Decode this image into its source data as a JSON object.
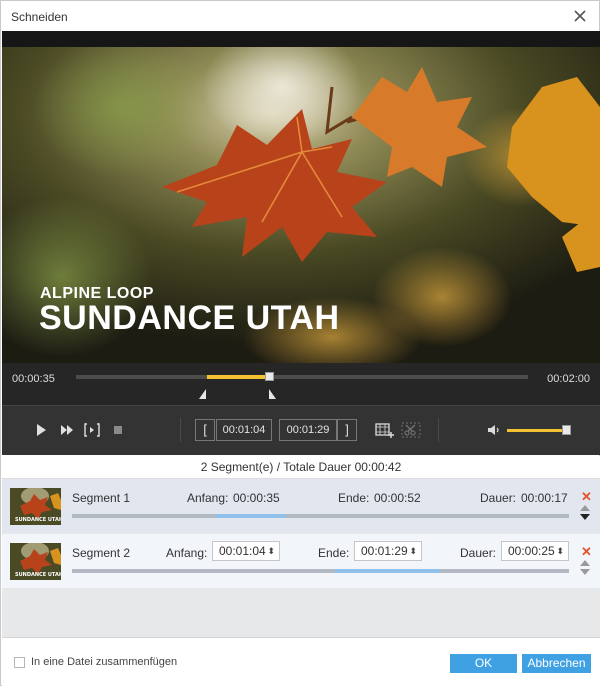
{
  "window": {
    "title": "Schneiden"
  },
  "video": {
    "overlay_subtitle": "ALPINE LOOP",
    "overlay_title": "SUNDANCE UTAH"
  },
  "timeline": {
    "current_time": "00:00:35",
    "total_time": "00:02:00",
    "selection_start_fraction": 0.29,
    "selection_end_fraction": 0.43,
    "accent_color": "#f2c230"
  },
  "controls": {
    "icons": [
      "play-icon",
      "fast-forward-icon",
      "frame-step-icon",
      "stop-icon",
      "set-start-bracket-icon",
      "set-end-bracket-icon",
      "add-segment-icon",
      "scissors-icon",
      "volume-icon"
    ],
    "start_marker": "[",
    "end_marker": "]",
    "start_time": "00:01:04",
    "end_time": "00:01:29",
    "volume_fraction": 0.92
  },
  "summary": {
    "text": "2 Segment(e) / Totale Dauer 00:00:42"
  },
  "segments": [
    {
      "name": "Segment 1",
      "start_label": "Anfang:",
      "start": "00:00:35",
      "end_label": "Ende:",
      "end": "00:00:52",
      "duration_label": "Dauer:",
      "duration": "00:00:17",
      "bar_start_fraction": 0.29,
      "bar_end_fraction": 0.43,
      "editable": false
    },
    {
      "name": "Segment 2",
      "start_label": "Anfang:",
      "start": "00:01:04",
      "end_label": "Ende:",
      "end": "00:01:29",
      "duration_label": "Dauer:",
      "duration": "00:00:25",
      "bar_start_fraction": 0.53,
      "bar_end_fraction": 0.74,
      "editable": true
    }
  ],
  "spinner_arrow": "⬍",
  "delete_glyph": "✕",
  "footer": {
    "merge_checkbox_label": "In eine Datei zusammenfügen",
    "merge_checked": false,
    "ok_label": "OK",
    "cancel_label": "Abbrechen",
    "button_color": "#3fa0e2"
  }
}
